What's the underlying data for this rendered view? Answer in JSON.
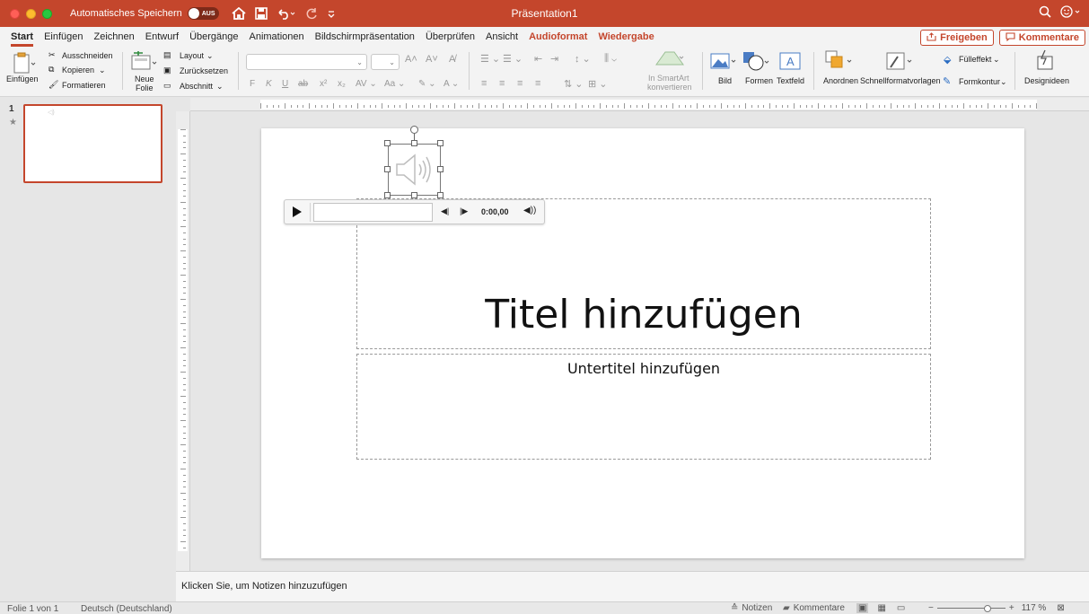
{
  "titlebar": {
    "autosave_label": "Automatisches Speichern",
    "autosave_state": "AUS",
    "document_title": "Präsentation1"
  },
  "tabs": [
    {
      "label": "Start",
      "active": true
    },
    {
      "label": "Einfügen"
    },
    {
      "label": "Zeichnen"
    },
    {
      "label": "Entwurf"
    },
    {
      "label": "Übergänge"
    },
    {
      "label": "Animationen"
    },
    {
      "label": "Bildschirmpräsentation"
    },
    {
      "label": "Überprüfen"
    },
    {
      "label": "Ansicht"
    },
    {
      "label": "Audioformat",
      "contextual": true
    },
    {
      "label": "Wiedergabe",
      "contextual": true
    }
  ],
  "share": {
    "freigeben": "Freigeben",
    "kommentare": "Kommentare"
  },
  "ribbon": {
    "einfuegen": "Einfügen",
    "ausschneiden": "Ausschneiden",
    "kopieren": "Kopieren",
    "formatieren": "Formatieren",
    "neue_folie_1": "Neue",
    "neue_folie_2": "Folie",
    "layout": "Layout",
    "zuruecksetzen": "Zurücksetzen",
    "abschnitt": "Abschnitt",
    "smartart_1": "In SmartArt",
    "smartart_2": "konvertieren",
    "bild": "Bild",
    "formen": "Formen",
    "textfeld": "Textfeld",
    "anordnen": "Anordnen",
    "schnellformat": "Schnellformatvorlagen",
    "fuelleffekt": "Fülleffekt",
    "formkontur": "Formkontur",
    "designideen": "Designideen"
  },
  "thumbnails": [
    {
      "number": "1",
      "star": "★"
    }
  ],
  "slide": {
    "title_placeholder": "Titel hinzufügen",
    "subtitle_placeholder": "Untertitel hinzufügen"
  },
  "player": {
    "time": "0:00,00"
  },
  "notes": {
    "placeholder": "Klicken Sie, um Notizen hinzuzufügen"
  },
  "status": {
    "slide_info": "Folie 1 von 1",
    "language": "Deutsch (Deutschland)",
    "notes_btn": "Notizen",
    "comments_btn": "Kommentare",
    "zoom": "117 %"
  },
  "colors": {
    "accent": "#c4462c",
    "canvas": "#e6e6e6"
  },
  "icons": [
    "home-icon",
    "save-icon",
    "undo-icon",
    "redo-icon",
    "search-icon",
    "smiley-icon",
    "speaker-icon",
    "play-icon"
  ]
}
